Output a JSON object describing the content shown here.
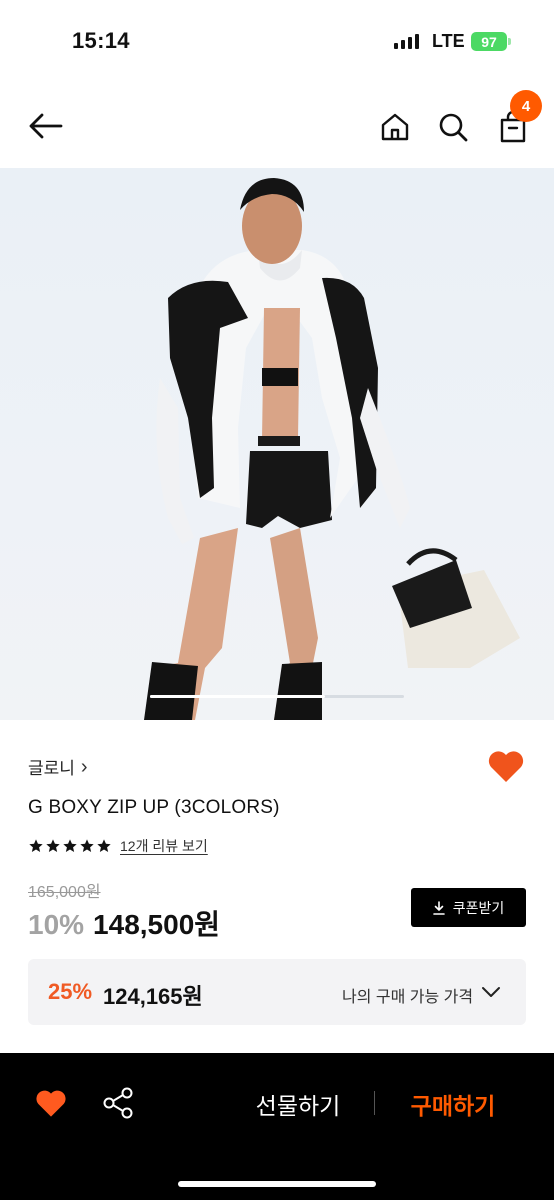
{
  "status_bar": {
    "time": "15:14",
    "network": "LTE",
    "battery": "97"
  },
  "nav": {
    "cart_count": "4"
  },
  "product": {
    "brand": "글로니",
    "brand_chevron": "›",
    "name": "G BOXY ZIP UP (3COLORS)",
    "rating_stars": 5,
    "review_link": "12개 리뷰 보기",
    "original_price": "165,000원",
    "discount_rate": "10%",
    "sale_price": "148,500원",
    "coupon_label": "쿠폰받기",
    "image_slider_progress": 0.69
  },
  "my_price": {
    "discount_rate": "25%",
    "price": "124,165원",
    "label": "나의 구매 가능 가격"
  },
  "bottom_bar": {
    "gift_label": "선물하기",
    "buy_label": "구매하기"
  },
  "colors": {
    "accent": "#ff5a00",
    "heart": "#f0541c",
    "black": "#000000"
  },
  "icons": [
    "back-arrow-icon",
    "home-icon",
    "search-icon",
    "cart-icon",
    "heart-icon",
    "star-icon",
    "download-icon",
    "chevron-down-icon",
    "share-icon"
  ]
}
